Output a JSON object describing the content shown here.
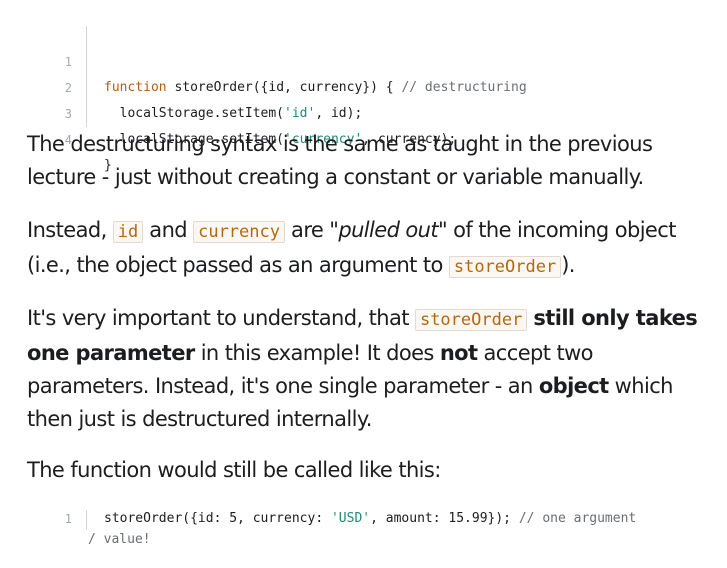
{
  "code_block_1": {
    "lines": [
      {
        "num": "1",
        "t1": "function",
        "t2": " storeOrder({id, currency}) { ",
        "t3": "// destructuring"
      },
      {
        "num": "2",
        "t1": "  localStorage.setItem(",
        "t2": "'id'",
        "t3": ", id);"
      },
      {
        "num": "3",
        "t1": "  localStorage.setItem(",
        "t2": "'currency'",
        "t3": ", currency);"
      },
      {
        "num": "4",
        "t1": "}"
      }
    ]
  },
  "paragraph_1": {
    "text": "The destructuring syntax is the same as taught in the previous lecture - just without creating a constant or variable manually."
  },
  "paragraph_2": {
    "s1": "Instead, ",
    "code_id": "id",
    "s2": " and ",
    "code_currency": "currency",
    "s3": " are ",
    "quote": "\"pulled out\"",
    "s4": " of the incoming object (i.e., the object passed as an argument to ",
    "code_fn": "storeOrder",
    "s5": ")."
  },
  "paragraph_3": {
    "s1": "It's very important to understand, that ",
    "code_fn": "storeOrder",
    "s2": " ",
    "b1": "still only takes one parameter",
    "s3": " in this example! It does ",
    "b2": "not",
    "s4": " accept two parameters. Instead, it's one single parameter - an ",
    "b3": "object",
    "s5": " which then just is destructured internally."
  },
  "paragraph_4": {
    "text": "The function would still be called like this:"
  },
  "code_block_2": {
    "num": "1",
    "p1": "storeOrder({id: 5, currency: ",
    "p2": "'USD'",
    "p3": ", amount: 15.99}); ",
    "p4": "// one argument",
    "p5": "/ value!"
  }
}
